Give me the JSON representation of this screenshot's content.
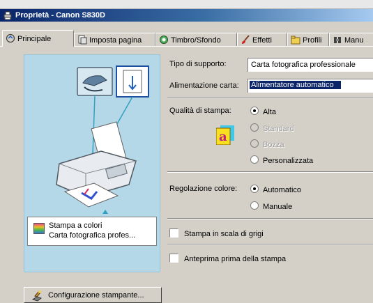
{
  "window": {
    "title": "Proprietà - Canon S830D"
  },
  "tabs": [
    {
      "label": "Principale",
      "active": true,
      "icon": "main-tab-icon"
    },
    {
      "label": "Imposta pagina",
      "active": false,
      "icon": "page-setup-icon"
    },
    {
      "label": "Timbro/Sfondo",
      "active": false,
      "icon": "stamp-icon"
    },
    {
      "label": "Effetti",
      "active": false,
      "icon": "effects-brush-icon"
    },
    {
      "label": "Profili",
      "active": false,
      "icon": "profiles-icon"
    },
    {
      "label": "Manu",
      "active": false,
      "icon": "maintenance-icon"
    }
  ],
  "preview": {
    "summary_line1": "Stampa a colori",
    "summary_line2": "Carta fotografica profes..."
  },
  "media": {
    "label": "Tipo di supporto:",
    "value": "Carta fotografica professionale"
  },
  "paper_source": {
    "label": "Alimentazione carta:",
    "value": "Alimentatore automatico"
  },
  "print_quality": {
    "label": "Qualità di stampa:",
    "options": [
      {
        "label": "Alta",
        "selected": true,
        "enabled": true
      },
      {
        "label": "Standard",
        "selected": false,
        "enabled": false
      },
      {
        "label": "Bozza",
        "selected": false,
        "enabled": false
      },
      {
        "label": "Personalizzata",
        "selected": false,
        "enabled": true
      }
    ]
  },
  "color_adjustment": {
    "label": "Regolazione colore:",
    "options": [
      {
        "label": "Automatico",
        "selected": true
      },
      {
        "label": "Manuale",
        "selected": false
      }
    ]
  },
  "grayscale": {
    "label": "Stampa in scala di grigi",
    "checked": false
  },
  "preview_before_print": {
    "label": "Anteprima prima della stampa",
    "checked": false
  },
  "printer_config_button": {
    "label": "Configurazione stampante..."
  },
  "colors": {
    "title_dark": "#0a246a",
    "title_light": "#a6caf0",
    "preview_bg": "#b4d8e8",
    "face": "#d4d0c8"
  }
}
